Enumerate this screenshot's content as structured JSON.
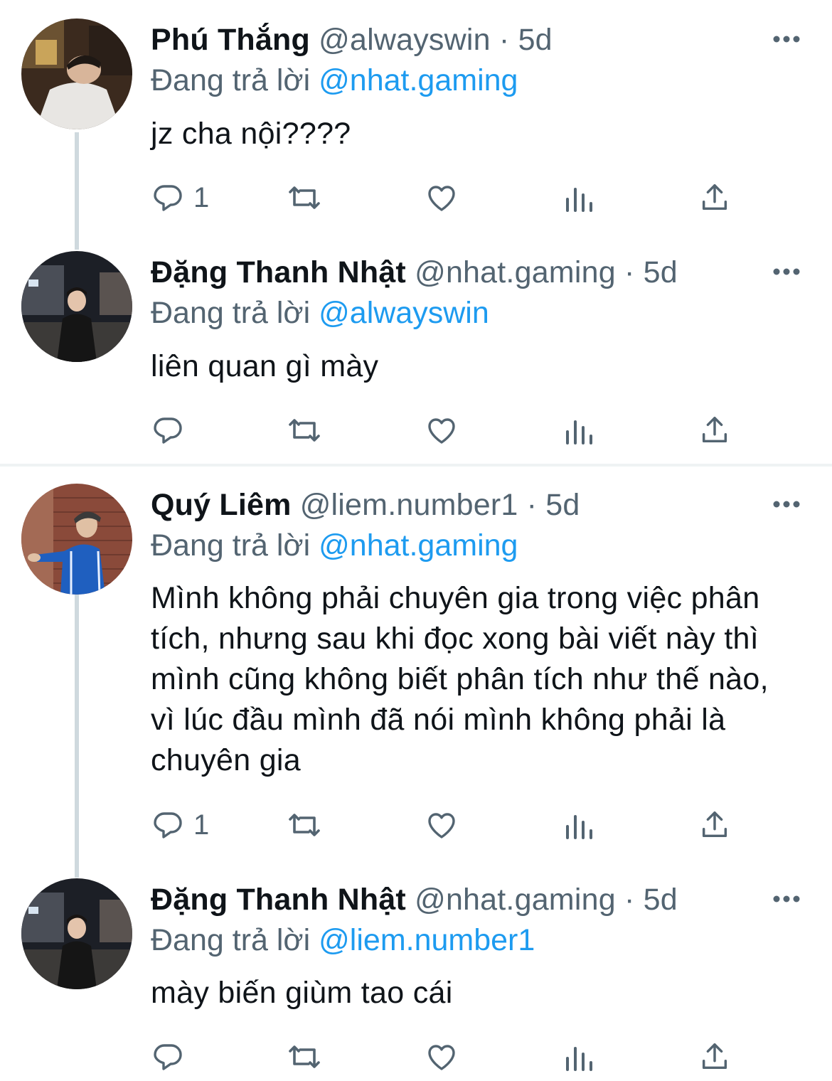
{
  "tweets": [
    {
      "name": "Phú Thắng",
      "handle": "@alwayswin",
      "separator": "·",
      "time": "5d",
      "reply_prefix": "Đang trả lời",
      "reply_to": "@nhat.gaming",
      "text": "jz cha nội????",
      "reply_count": "1",
      "avatar_icon": "person-photo-avatar"
    },
    {
      "name": "Đặng Thanh Nhật",
      "handle": "@nhat.gaming",
      "separator": "·",
      "time": "5d",
      "reply_prefix": "Đang trả lời",
      "reply_to": "@alwayswin",
      "text": "liên quan gì mày",
      "reply_count": "",
      "avatar_icon": "person-photo-avatar"
    },
    {
      "name": "Quý Liêm",
      "handle": "@liem.number1",
      "separator": "·",
      "time": "5d",
      "reply_prefix": "Đang trả lời",
      "reply_to": "@nhat.gaming",
      "text": "Mình không phải chuyên gia trong việc phân tích, nhưng sau khi đọc xong bài viết này thì mình cũng không biết phân tích như thế nào, vì lúc đầu mình đã nói mình không phải là chuyên gia",
      "reply_count": "1",
      "avatar_icon": "person-photo-avatar"
    },
    {
      "name": "Đặng Thanh Nhật",
      "handle": "@nhat.gaming",
      "separator": "·",
      "time": "5d",
      "reply_prefix": "Đang trả lời",
      "reply_to": "@liem.number1",
      "text": "mày biến giùm tao cái",
      "reply_count": "",
      "avatar_icon": "person-photo-avatar"
    }
  ],
  "icons": {
    "reply": "reply-icon",
    "retweet": "retweet-icon",
    "like": "heart-icon",
    "views": "views-icon",
    "share": "share-icon",
    "more": "more-icon"
  },
  "colors": {
    "text": "#0f1419",
    "secondary": "#536471",
    "link": "#1d9bf0",
    "thread_line": "#cfd9de",
    "divider": "#eff3f4"
  }
}
